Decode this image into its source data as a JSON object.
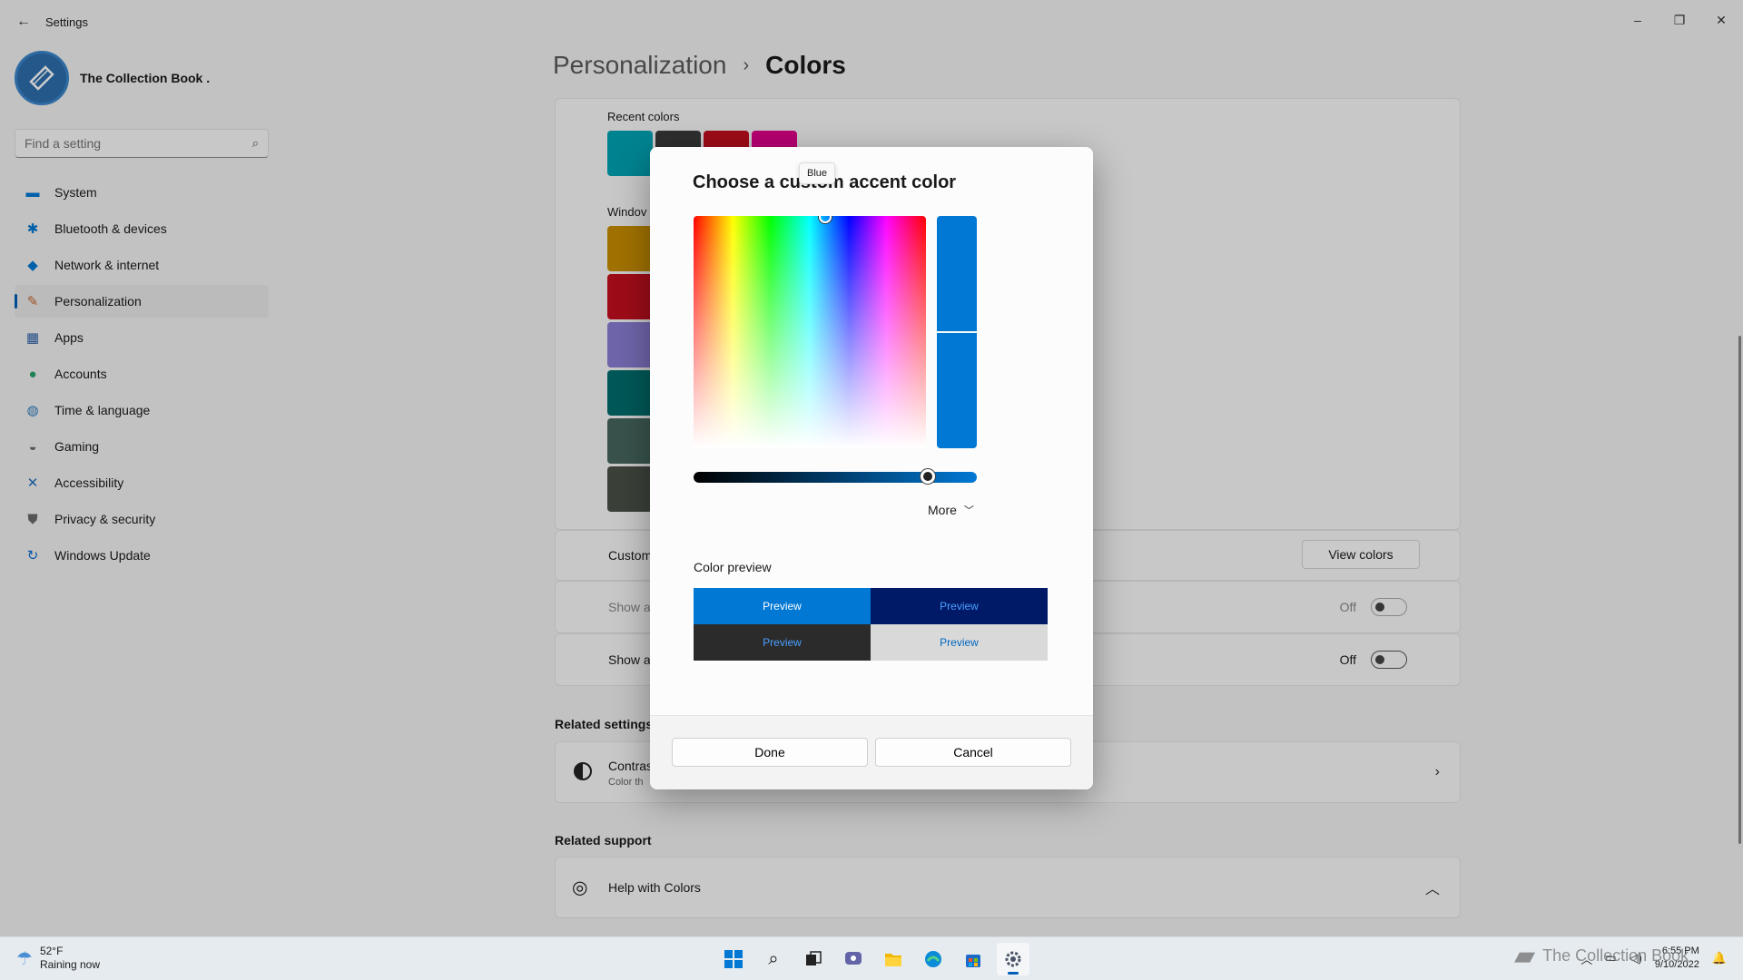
{
  "window": {
    "title": "Settings",
    "back_icon": "back-arrow-icon",
    "minimize": "–",
    "maximize": "❐",
    "close": "✕"
  },
  "profile": {
    "name": "The Collection Book ."
  },
  "search": {
    "placeholder": "Find a setting"
  },
  "sidebar": {
    "items": [
      {
        "label": "System",
        "icon": "system-icon",
        "color": "#0078d4",
        "glyph": "▬"
      },
      {
        "label": "Bluetooth & devices",
        "icon": "bluetooth-icon",
        "color": "#0078d4",
        "glyph": "✱"
      },
      {
        "label": "Network & internet",
        "icon": "wifi-icon",
        "color": "#0078d4",
        "glyph": "◆"
      },
      {
        "label": "Personalization",
        "icon": "brush-icon",
        "color": "#c96a2d",
        "glyph": "✎",
        "active": true
      },
      {
        "label": "Apps",
        "icon": "apps-icon",
        "color": "#2b5fa8",
        "glyph": "▦"
      },
      {
        "label": "Accounts",
        "icon": "accounts-icon",
        "color": "#2aa36b",
        "glyph": "●"
      },
      {
        "label": "Time & language",
        "icon": "globe-clock-icon",
        "color": "#2f7fc0",
        "glyph": "◍"
      },
      {
        "label": "Gaming",
        "icon": "gaming-icon",
        "color": "#6b6b6b",
        "glyph": "◒"
      },
      {
        "label": "Accessibility",
        "icon": "accessibility-icon",
        "color": "#1f6fbf",
        "glyph": "✕"
      },
      {
        "label": "Privacy & security",
        "icon": "shield-icon",
        "color": "#6b6b6b",
        "glyph": "⛊"
      },
      {
        "label": "Windows Update",
        "icon": "update-icon",
        "color": "#0a6fd1",
        "glyph": "↻"
      }
    ]
  },
  "breadcrumb": {
    "parent": "Personalization",
    "separator": "›",
    "current": "Colors"
  },
  "content": {
    "recent_label": "Recent colors",
    "recent_colors": [
      "#00a4b4",
      "#3a3a3a",
      "#c50f1f",
      "#e3008c"
    ],
    "windows_label": "Windov",
    "windows_colors": [
      "#ca8f00",
      "#c50f1f",
      "#8b7fd6",
      "#006e6e",
      "#486860",
      "#4a5148"
    ],
    "custom_row": "Custom",
    "view_colors": "View colors",
    "show_row_1": "Show a",
    "show_row_2": "Show a",
    "toggle_1": "Off",
    "toggle_2": "Off",
    "related_settings": "Related settings",
    "contrast_title": "Contras",
    "contrast_sub": "Color th",
    "related_support": "Related support",
    "help_colors": "Help with Colors"
  },
  "dialog": {
    "title": "Choose a custom accent color",
    "tooltip": "Blue",
    "selected_color": "#0078d4",
    "more": "More",
    "preview_label": "Color preview",
    "previews": [
      {
        "text": "Preview",
        "bg": "#0078d4",
        "fg": "#ffffff"
      },
      {
        "text": "Preview",
        "bg": "#001a68",
        "fg": "#4aa0ff"
      },
      {
        "text": "Preview",
        "bg": "#2b2b2b",
        "fg": "#4aa0ff"
      },
      {
        "text": "Preview",
        "bg": "#d9d9d9",
        "fg": "#0067c0"
      }
    ],
    "done": "Done",
    "cancel": "Cancel"
  },
  "taskbar": {
    "weather_temp": "52°F",
    "weather_desc": "Raining now",
    "apps": [
      "start-icon",
      "search-icon",
      "task-view-icon",
      "chat-icon",
      "file-explorer-icon",
      "edge-icon",
      "store-icon",
      "settings-icon"
    ],
    "time": "6:55 PM",
    "date": "9/10/2022",
    "watermark": "The Collection Book"
  }
}
